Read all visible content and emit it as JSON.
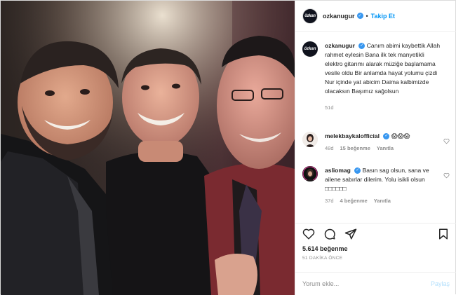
{
  "header": {
    "username": "ozkanugur",
    "separator": "•",
    "follow_label": "Takip Et",
    "avatar_logo": "özkan"
  },
  "caption": {
    "username": "ozkanugur",
    "text": "Canım abimi kaybettik Allah rahmet eylesin Bana ilk tek manyetikli elektro gitarımı alarak müziğe başlamama vesile oldu Bir anlamda hayat yolumu çizdi Nur içinde yat abicim Daima kalbimizde olacaksın Başımız sağolsun",
    "age": "51d"
  },
  "comments": [
    {
      "username": "melekbaykalofficial",
      "text": "😱😱😱",
      "age": "48d",
      "likes": "15 beğenme",
      "reply_label": "Yanıtla"
    },
    {
      "username": "asliomag",
      "text": "Basın sag olsun, sana ve ailene sabırlar dilerim. Yolu isikli olsun □□□□□□",
      "age": "37d",
      "likes": "4 beğenme",
      "reply_label": "Yanıtla"
    }
  ],
  "likes_count": "5.614 beğenme",
  "timestamp": "51 DAKİKA ÖNCE",
  "add_comment": {
    "placeholder": "Yorum ekle...",
    "post_label": "Paylaş"
  },
  "icons": [
    "verified-badge-icon",
    "heart-icon",
    "comment-icon",
    "share-icon",
    "bookmark-icon"
  ],
  "colors": {
    "link_blue": "#0095f6",
    "verified_blue": "#3897f0",
    "muted_gray": "#8e8e8e",
    "text": "#262626",
    "border": "#efefef"
  }
}
